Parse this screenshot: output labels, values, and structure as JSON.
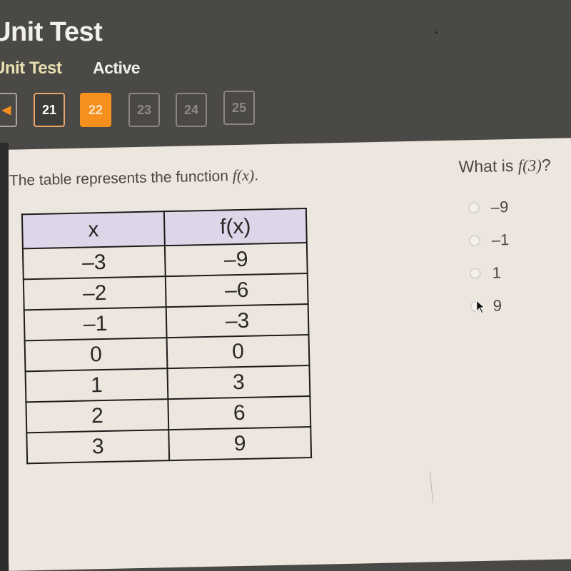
{
  "header": {
    "title": "Unit Test",
    "subtitle": "Unit Test",
    "status": "Active"
  },
  "nav": {
    "back_icon": "triangle-left-icon",
    "back_glyph": "◀",
    "questions": [
      {
        "label": "21",
        "state": "visited"
      },
      {
        "label": "22",
        "state": "current"
      },
      {
        "label": "23",
        "state": "unvisited"
      },
      {
        "label": "24",
        "state": "unvisited"
      },
      {
        "label": "25",
        "state": "unvisited"
      }
    ]
  },
  "prompt": {
    "text": "The table represents the function ",
    "func": "f(x)",
    "end": "."
  },
  "table": {
    "headers": [
      "x",
      "f(x)"
    ],
    "rows": [
      [
        "–3",
        "–9"
      ],
      [
        "–2",
        "–6"
      ],
      [
        "–1",
        "–3"
      ],
      [
        "0",
        "0"
      ],
      [
        "1",
        "3"
      ],
      [
        "2",
        "6"
      ],
      [
        "3",
        "9"
      ]
    ]
  },
  "question": {
    "text": "What is ",
    "func": "f(3)",
    "end": "?"
  },
  "options": [
    {
      "label": "–9",
      "selected": false
    },
    {
      "label": "–1",
      "selected": false
    },
    {
      "label": "1",
      "selected": false
    },
    {
      "label": "9",
      "selected": false
    }
  ],
  "colors": {
    "accent": "#f5901e",
    "header_bg": "#4b4946",
    "content_bg": "#ede6df",
    "table_header_bg": "#ddd5e8"
  }
}
